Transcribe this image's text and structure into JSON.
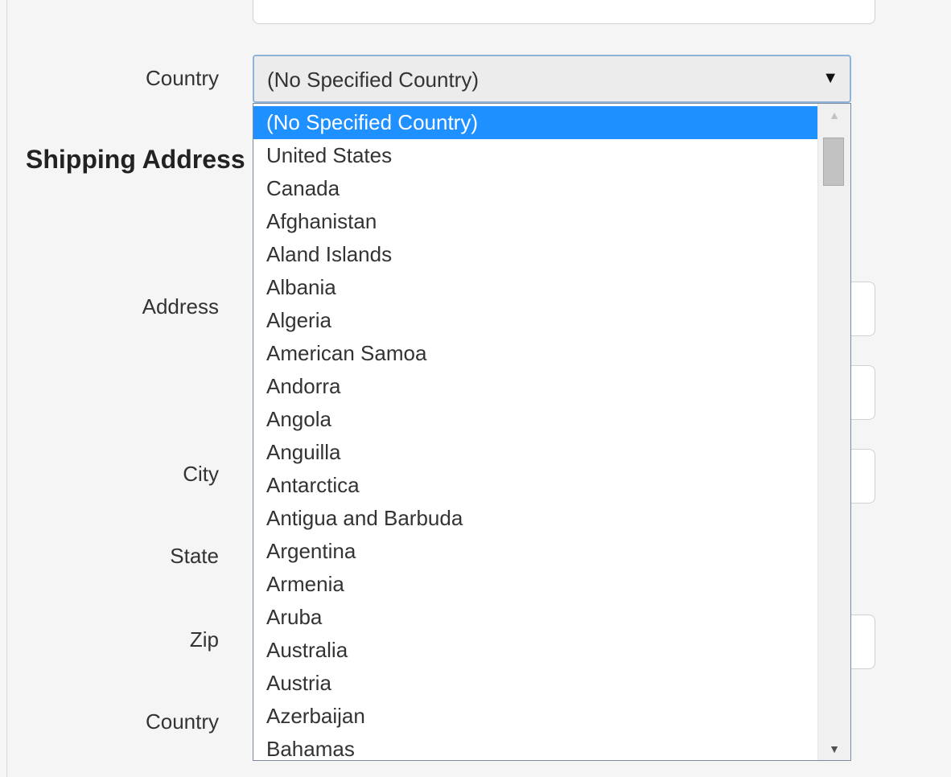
{
  "form": {
    "country_label": "Country",
    "shipping_heading": "Shipping Address",
    "address_label": "Address",
    "city_label": "City",
    "state_label": "State",
    "zip_label": "Zip",
    "shipping_country_label": "Country"
  },
  "country_select": {
    "value": "(No Specified Country)",
    "arrow_icon": "caret-down-icon",
    "options": [
      "(No Specified Country)",
      "United States",
      "Canada",
      "Afghanistan",
      "Aland Islands",
      "Albania",
      "Algeria",
      "American Samoa",
      "Andorra",
      "Angola",
      "Anguilla",
      "Antarctica",
      "Antigua and Barbuda",
      "Argentina",
      "Armenia",
      "Aruba",
      "Australia",
      "Austria",
      "Azerbaijan",
      "Bahamas"
    ],
    "selected_index": 0,
    "highlight_color": "#1e90ff"
  }
}
